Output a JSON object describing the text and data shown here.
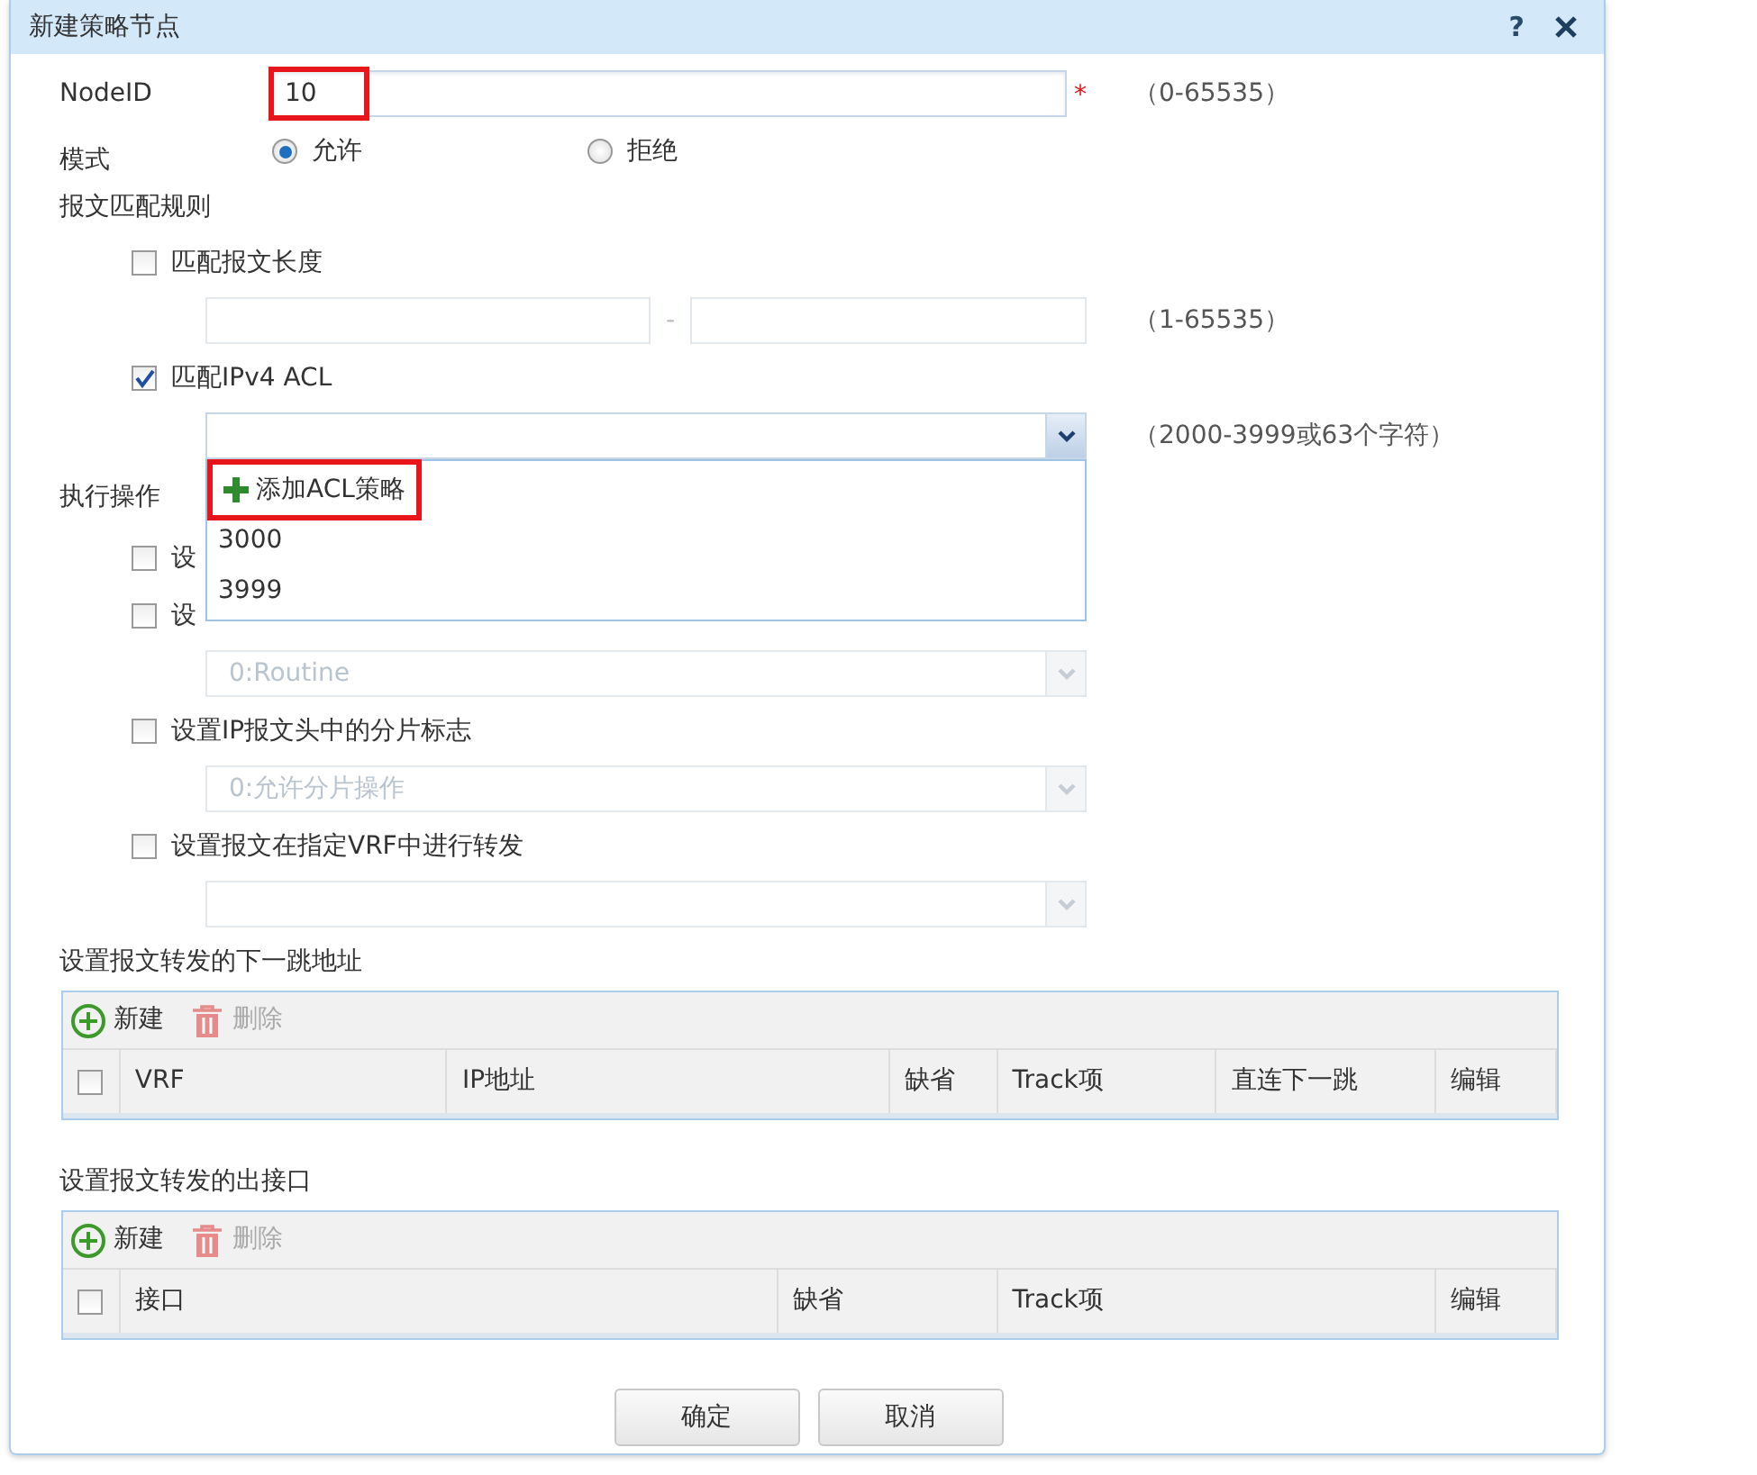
{
  "dialog": {
    "title": "新建策略节点",
    "help": "?"
  },
  "node_id": {
    "label": "NodeID",
    "value": "10",
    "required_mark": "*",
    "hint": "（0-65535）",
    "highlighted": true
  },
  "mode": {
    "label": "模式",
    "options": [
      {
        "label": "允许",
        "selected": true
      },
      {
        "label": "拒绝",
        "selected": false
      }
    ]
  },
  "match_rules": {
    "heading": "报文匹配规则",
    "items": [
      {
        "kind": "range",
        "label": "匹配报文长度",
        "checked": false,
        "separator": "-",
        "hint": "（1-65535）"
      },
      {
        "kind": "select",
        "label": "匹配IPv4 ACL",
        "checked": true,
        "hint": "（2000-3999或63个字符）",
        "dropdown": [
          {
            "kind": "add",
            "label": "添加ACL策略",
            "highlighted": true
          },
          {
            "kind": "option",
            "label": "3000",
            "highlighted": false
          },
          {
            "kind": "option",
            "label": "3999",
            "highlighted": false
          }
        ]
      }
    ]
  },
  "actions": {
    "heading": "执行操作",
    "items": [
      {
        "kind": "plain",
        "label": "设",
        "checked": false
      },
      {
        "kind": "plain",
        "label": "设",
        "checked": false
      },
      {
        "kind": "select",
        "select_value": "0:Routine",
        "select_disabled": true
      },
      {
        "kind": "check",
        "label": "设置IP报文头中的分片标志",
        "checked": false
      },
      {
        "kind": "select",
        "select_value": "0:允许分片操作",
        "select_disabled": true
      },
      {
        "kind": "check",
        "label": "设置报文在指定VRF中进行转发",
        "checked": false
      },
      {
        "kind": "select",
        "select_disabled": true
      }
    ]
  },
  "tables": [
    {
      "heading": "设置报文转发的下一跳地址",
      "toolbar": [
        {
          "kind": "add",
          "label": "新建",
          "disabled": false
        },
        {
          "kind": "delete",
          "label": "删除",
          "disabled": true
        }
      ],
      "select_all": false,
      "columns": [
        "VRF",
        "IP地址",
        "缺省",
        "Track项",
        "直连下一跳",
        "编辑"
      ]
    },
    {
      "heading": "设置报文转发的出接口",
      "toolbar": [
        {
          "kind": "add",
          "label": "新建",
          "disabled": false
        },
        {
          "kind": "delete",
          "label": "删除",
          "disabled": true
        }
      ],
      "select_all": false,
      "columns": [
        "接口",
        "缺省",
        "Track项",
        "编辑"
      ]
    }
  ],
  "buttons": [
    "确定",
    "取消"
  ]
}
